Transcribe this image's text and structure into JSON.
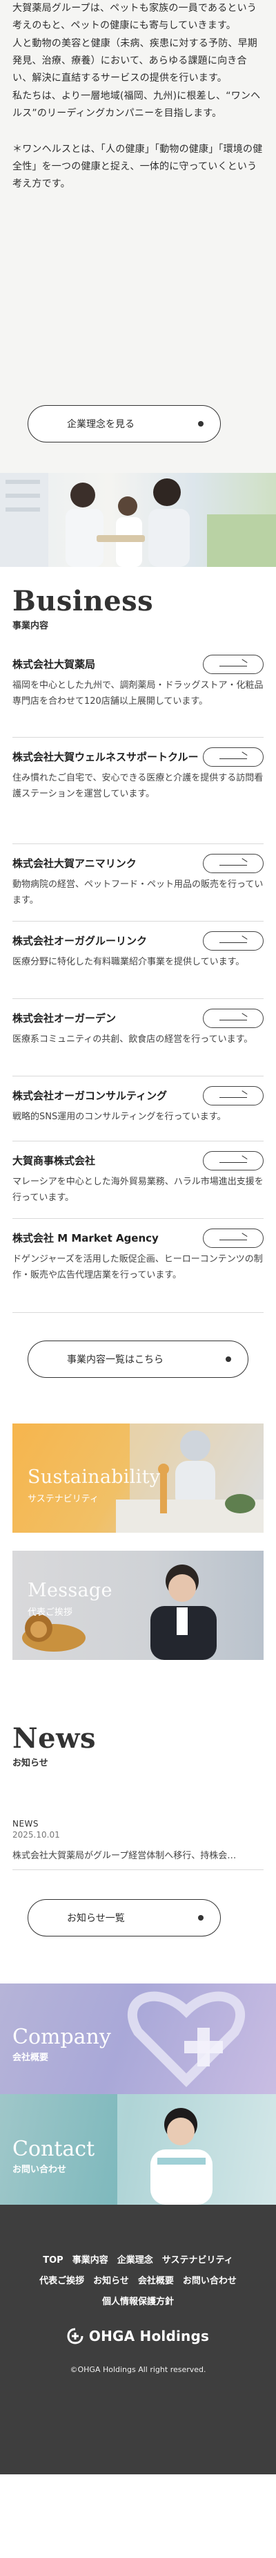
{
  "intro": {
    "paragraphs": [
      "大賀薬局グループは、ペットも家族の一員であるという考えのもと、ペットの健康にも寄与していきます。",
      "人と動物の美容と健康（未病、疾患に対する予防、早期発見、治療、療養）において、あらゆる課題に向き合い、解決に直結するサービスの提供を行います。",
      "私たちは、より一層地域(福岡、九州)に根差し、“ワンヘルス”のリーディングカンパニーを目指します。",
      "＊ワンヘルスとは、「人の健康」「動物の健康」「環境の健全性」を一つの健康と捉え、一体的に守っていくという考え方です。"
    ],
    "button_label": "企業理念を見る"
  },
  "business": {
    "title": "Business",
    "subtitle": "事業内容",
    "items": [
      {
        "name": "株式会社大賀薬局",
        "desc": "福岡を中心とした九州で、調剤薬局・ドラッグストア・化粧品専門店を合わせて120店舗以上展開しています。"
      },
      {
        "name": "株式会社大賀ウェルネスサポートクルー",
        "desc": "住み慣れたご自宅で、安心できる医療と介護を提供する訪問看護ステーションを運営しています。"
      },
      {
        "name": "株式会社大賀アニマリンク",
        "desc": "動物病院の経営、ペットフード・ペット用品の販売を行っています。"
      },
      {
        "name": "株式会社オーガグルーリンク",
        "desc": "医療分野に特化した有料職業紹介事業を提供しています。"
      },
      {
        "name": "株式会社オーガーデン",
        "desc": "医療系コミュニティの共創、飲食店の経営を行っています。"
      },
      {
        "name": "株式会社オーガコンサルティング",
        "desc": "戦略的SNS運用のコンサルティングを行っています。"
      },
      {
        "name": "大賀商事株式会社",
        "desc": "マレーシアを中心とした海外貿易業務、ハラル市場進出支援を行っています。"
      },
      {
        "name": "株式会社 M Market Agency",
        "desc": "ドゲンジャーズを活用した販促企画、ヒーローコンテンツの制作・販売や広告代理店業を行っています。"
      }
    ],
    "list_button": "事業内容一覧はこちら"
  },
  "banners": {
    "sustainability": {
      "en": "Sustainability",
      "jp": "サステナビリティ"
    },
    "message": {
      "en": "Message",
      "jp": "代表ご挨拶"
    }
  },
  "news": {
    "title": "News",
    "subtitle": "お知らせ",
    "items": [
      {
        "category": "NEWS",
        "date": "2025.10.01",
        "title": "株式会社大賀薬局がグループ経営体制へ移行、持株会…"
      }
    ],
    "button_label": "お知らせ一覧"
  },
  "tiles": {
    "company": {
      "en": "Company",
      "jp": "会社概要"
    },
    "contact": {
      "en": "Contact",
      "jp": "お問い合わせ"
    }
  },
  "footer": {
    "links_row1": [
      "TOP",
      "事業内容",
      "企業理念",
      "サステナビリティ"
    ],
    "links_row2": [
      "代表ご挨拶",
      "お知らせ",
      "会社概要",
      "お問い合わせ"
    ],
    "links_row3": [
      "個人情報保護方針"
    ],
    "logo_text": "OHGA Holdings",
    "copyright": "©OHGA Holdings All right reserved."
  },
  "colors": {
    "intro_bg": "#f5f5f3",
    "footer_bg": "#3e3e3e",
    "sustainability_accent": "#f6b54d",
    "company_accent": "#b6b4d8",
    "contact_accent": "#9fc7c9"
  }
}
